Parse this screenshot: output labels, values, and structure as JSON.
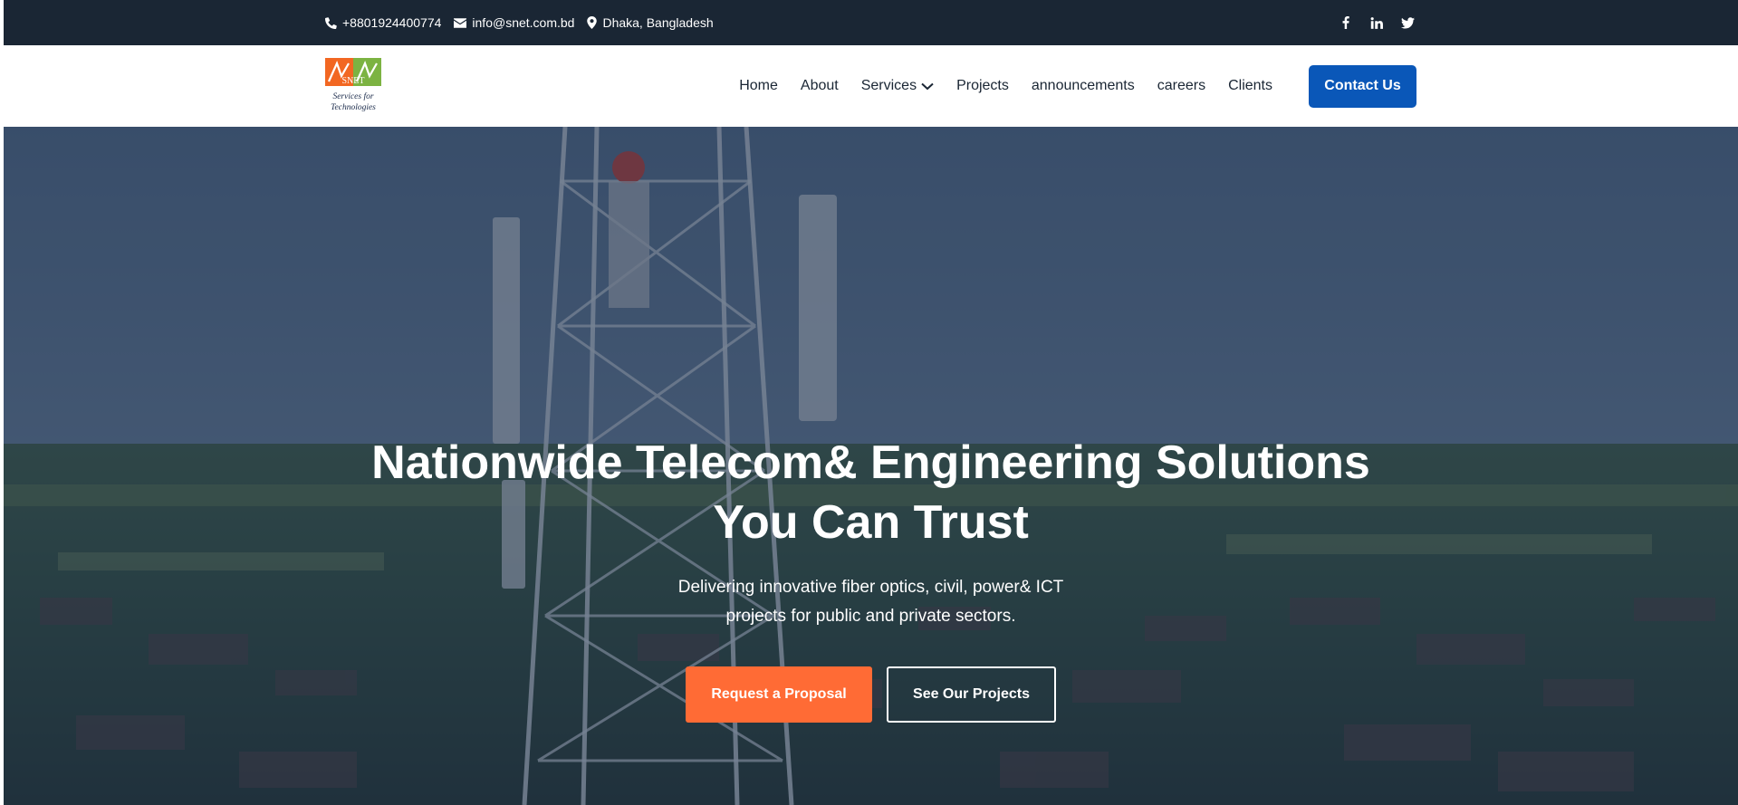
{
  "topbar": {
    "phone": "+8801924400774",
    "email": "info@snet.com.bd",
    "location": "Dhaka, Bangladesh",
    "icons": [
      "phone-icon",
      "envelope-icon",
      "map-pin-icon"
    ],
    "social": [
      "facebook-icon",
      "linkedin-icon",
      "twitter-icon"
    ],
    "background_color": "#1a2634"
  },
  "header": {
    "logo": {
      "brand": "SNET",
      "tagline_line1": "Services for",
      "tagline_line2": "Technologies"
    },
    "nav": [
      {
        "label": "Home"
      },
      {
        "label": "About"
      },
      {
        "label": "Services",
        "has_dropdown": true
      },
      {
        "label": "Projects"
      },
      {
        "label": "announcements"
      },
      {
        "label": "careers"
      },
      {
        "label": "Clients"
      }
    ],
    "cta_label": "Contact Us",
    "cta_color": "#0a57b8"
  },
  "hero": {
    "title_line1": "Nationwide Telecom& Engineering Solutions",
    "title_line2": "You Can Trust",
    "subtitle_line1": "Delivering innovative fiber optics, civil, power& ICT",
    "subtitle_line2": "projects for public and private sectors.",
    "primary_button": "Request a Proposal",
    "secondary_button": "See Our Projects",
    "primary_color": "#ff6b35",
    "overlay_color": "#162644"
  }
}
